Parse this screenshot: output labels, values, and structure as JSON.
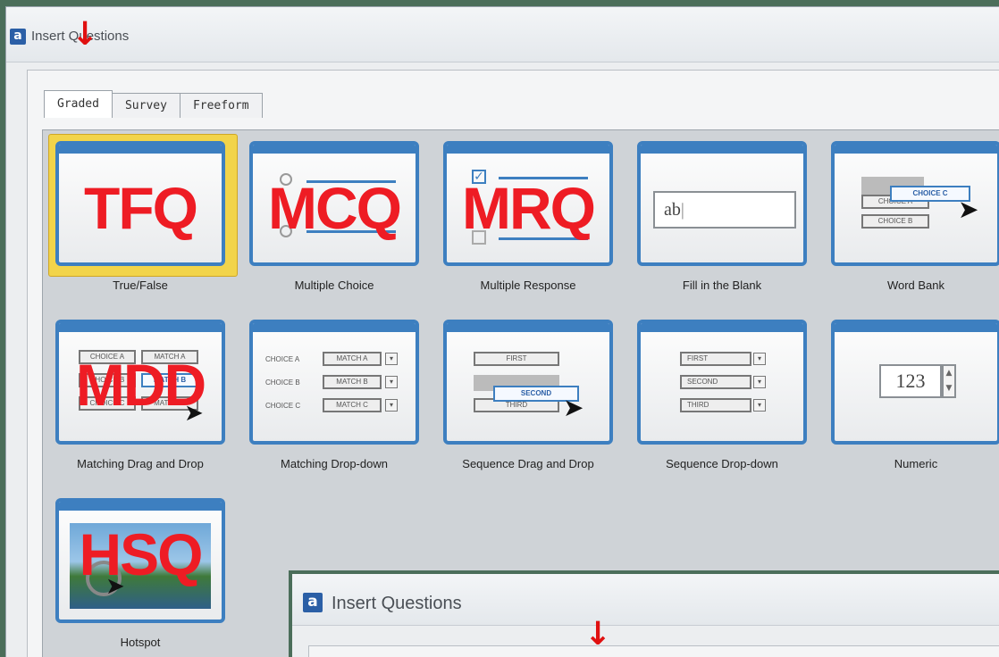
{
  "window": {
    "title": "Insert Questions",
    "app_icon": "a"
  },
  "tabs": [
    {
      "label": "Graded",
      "active": true
    },
    {
      "label": "Survey",
      "active": false
    },
    {
      "label": "Freeform",
      "active": false
    }
  ],
  "question_types": [
    {
      "label": "True/False",
      "overlay": "TFQ",
      "icon": "true-false-icon",
      "selected": true
    },
    {
      "label": "Multiple Choice",
      "overlay": "MCQ",
      "icon": "multiple-choice-icon"
    },
    {
      "label": "Multiple Response",
      "overlay": "MRQ",
      "icon": "multiple-response-icon"
    },
    {
      "label": "Fill in the Blank",
      "overlay": "",
      "icon": "fill-blank-icon",
      "field_text": "ab"
    },
    {
      "label": "Word Bank",
      "overlay": "",
      "icon": "word-bank-icon",
      "choices": [
        "CHOICE C",
        "CHOICE A",
        "CHOICE B"
      ]
    },
    {
      "label": "Matching Drag and Drop",
      "overlay": "MDD",
      "icon": "matching-drag-drop-icon",
      "choices": [
        "CHOICE A",
        "MATCH A",
        "CHOICE B",
        "MATCH B",
        "CHOICE C",
        "MATCH C"
      ]
    },
    {
      "label": "Matching Drop-down",
      "overlay": "",
      "icon": "matching-dropdown-icon",
      "rows": [
        {
          "choice": "CHOICE A",
          "match": "MATCH A"
        },
        {
          "choice": "CHOICE B",
          "match": "MATCH B"
        },
        {
          "choice": "CHOICE C",
          "match": "MATCH C"
        }
      ]
    },
    {
      "label": "Sequence Drag and Drop",
      "overlay": "",
      "icon": "sequence-drag-drop-icon",
      "items": [
        "FIRST",
        "SECOND",
        "THIRD"
      ]
    },
    {
      "label": "Sequence Drop-down",
      "overlay": "",
      "icon": "sequence-dropdown-icon",
      "items": [
        "FIRST",
        "SECOND",
        "THIRD"
      ]
    },
    {
      "label": "Numeric",
      "overlay": "",
      "icon": "numeric-icon",
      "value": "123"
    },
    {
      "label": "Hotspot",
      "overlay": "HSQ",
      "icon": "hotspot-icon"
    }
  ],
  "second_window": {
    "title": "Insert Questions",
    "app_icon": "a"
  },
  "annotation_arrow": "↓",
  "colors": {
    "accent": "#3d7fc0",
    "overlay_red": "#ee1c24",
    "selection": "#f2d44a"
  }
}
